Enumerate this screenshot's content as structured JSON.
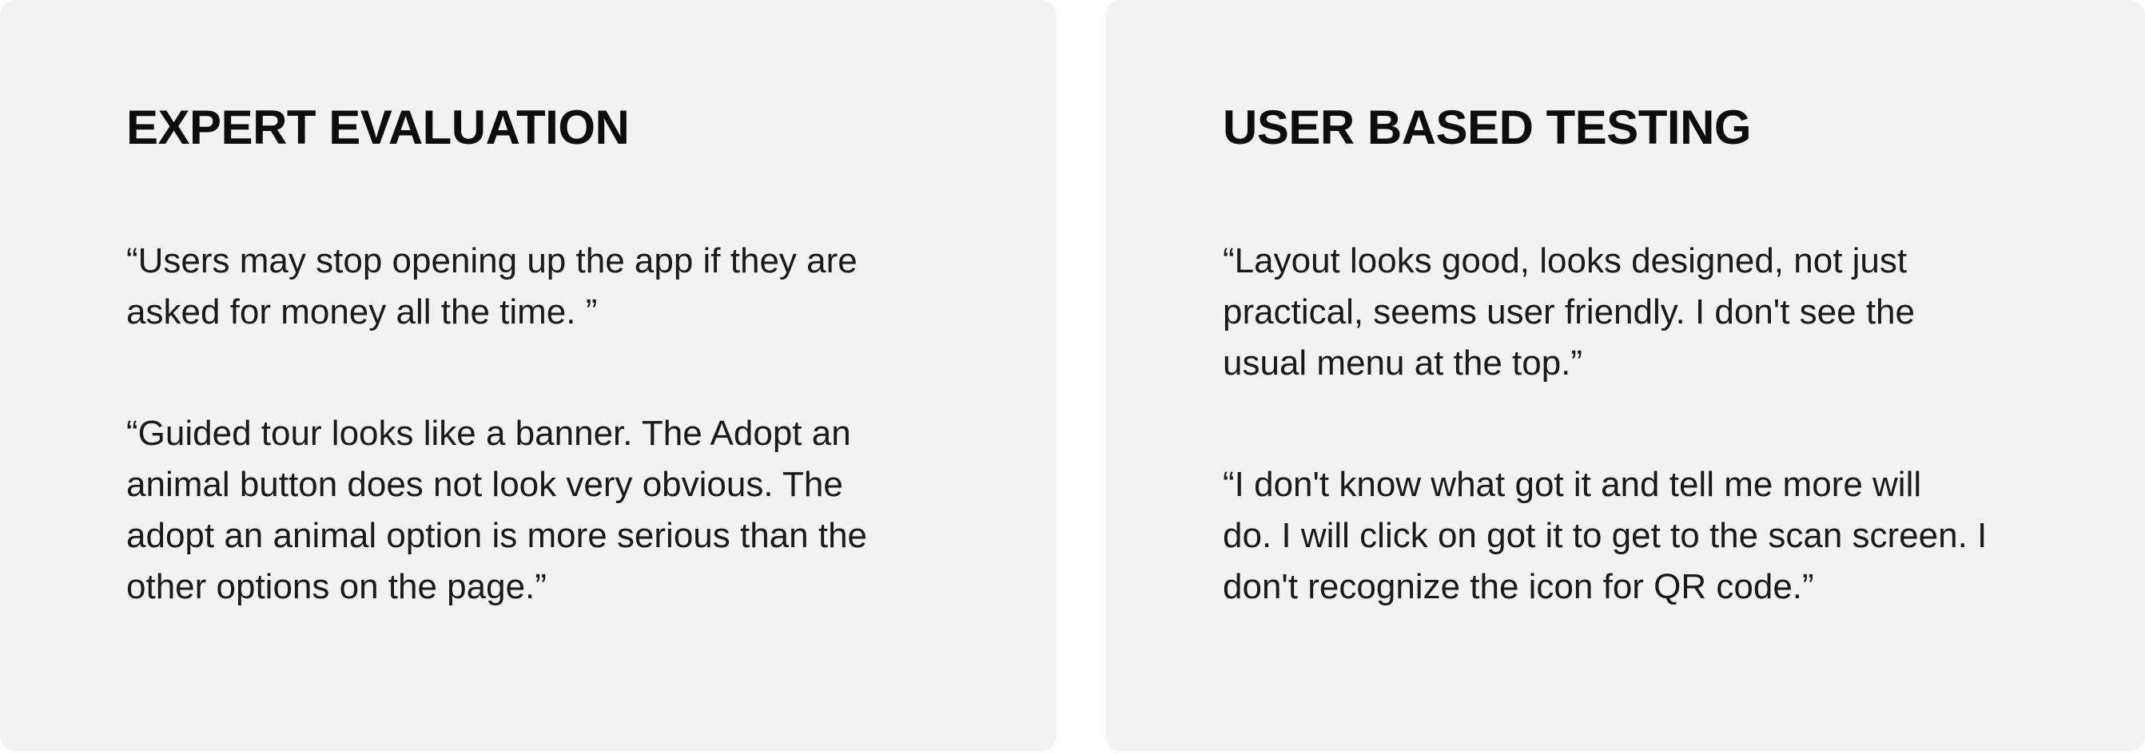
{
  "panels": [
    {
      "heading": "EXPERT EVALUATION",
      "quotes": [
        {
          "lines": [
            "“Users may stop opening up the app if they are",
            "asked for money all the time. ”"
          ]
        },
        {
          "lines": [
            "“Guided tour looks like a banner. The Adopt an",
            "animal button does not look very obvious. The",
            "adopt an animal option is more serious than the",
            "other options on the page.”"
          ]
        }
      ]
    },
    {
      "heading": "USER BASED TESTING",
      "quotes": [
        {
          "lines": [
            "“Layout looks good, looks designed, not just",
            "practical, seems user friendly. I don't see the",
            "usual menu at the top.”"
          ]
        },
        {
          "lines": [
            "“I don't know what got it and tell me more will",
            "do. I will click on got it to get to the scan screen. I",
            "don't recognize the icon for QR code.”"
          ]
        }
      ]
    }
  ],
  "colors": {
    "card_background": "#f2f2f2",
    "page_background": "#ffffff",
    "text": "#111111"
  }
}
